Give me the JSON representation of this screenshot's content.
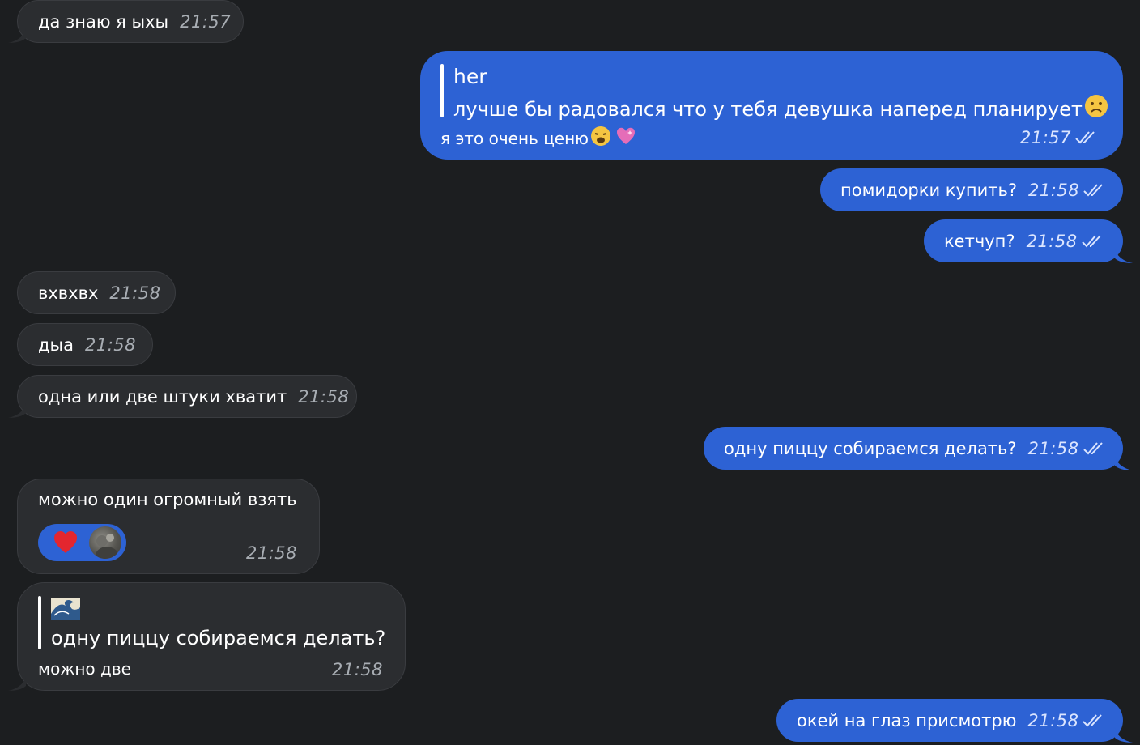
{
  "colors": {
    "background": "#1c1e20",
    "incoming_bubble": "#2b2d30",
    "outgoing_bubble": "#2d62d4",
    "timestamp_in": "#a8adb3",
    "timestamp_out": "#dbe5ff"
  },
  "messages": [
    {
      "direction": "in",
      "text": "да знаю я ыхы",
      "time": "21:57"
    },
    {
      "direction": "out",
      "reply_author": "her",
      "reply_text": "лучше бы радовался что у тебя девушка наперед планирует",
      "text": "я это очень ценю",
      "time": "21:57",
      "read": true
    },
    {
      "direction": "out",
      "text": "помидорки купить?",
      "time": "21:58",
      "read": true
    },
    {
      "direction": "out",
      "text": "кетчуп?",
      "time": "21:58",
      "read": true
    },
    {
      "direction": "in",
      "text": "вхвхвх",
      "time": "21:58"
    },
    {
      "direction": "in",
      "text": "дыа",
      "time": "21:58"
    },
    {
      "direction": "in",
      "text": "одна или две штуки хватит",
      "time": "21:58"
    },
    {
      "direction": "out",
      "text": "одну пиццу собираемся делать?",
      "time": "21:58",
      "read": true
    },
    {
      "direction": "in",
      "text": "можно один огромный взять",
      "time": "21:58",
      "reaction": "heart-emoji"
    },
    {
      "direction": "in",
      "reply_author_icon": "wave-emoji",
      "reply_text": "одну пиццу собираемся делать?",
      "text": "можно две",
      "time": "21:58"
    },
    {
      "direction": "out",
      "text": "окей на глаз присмотрю",
      "time": "21:58",
      "read": true
    }
  ]
}
